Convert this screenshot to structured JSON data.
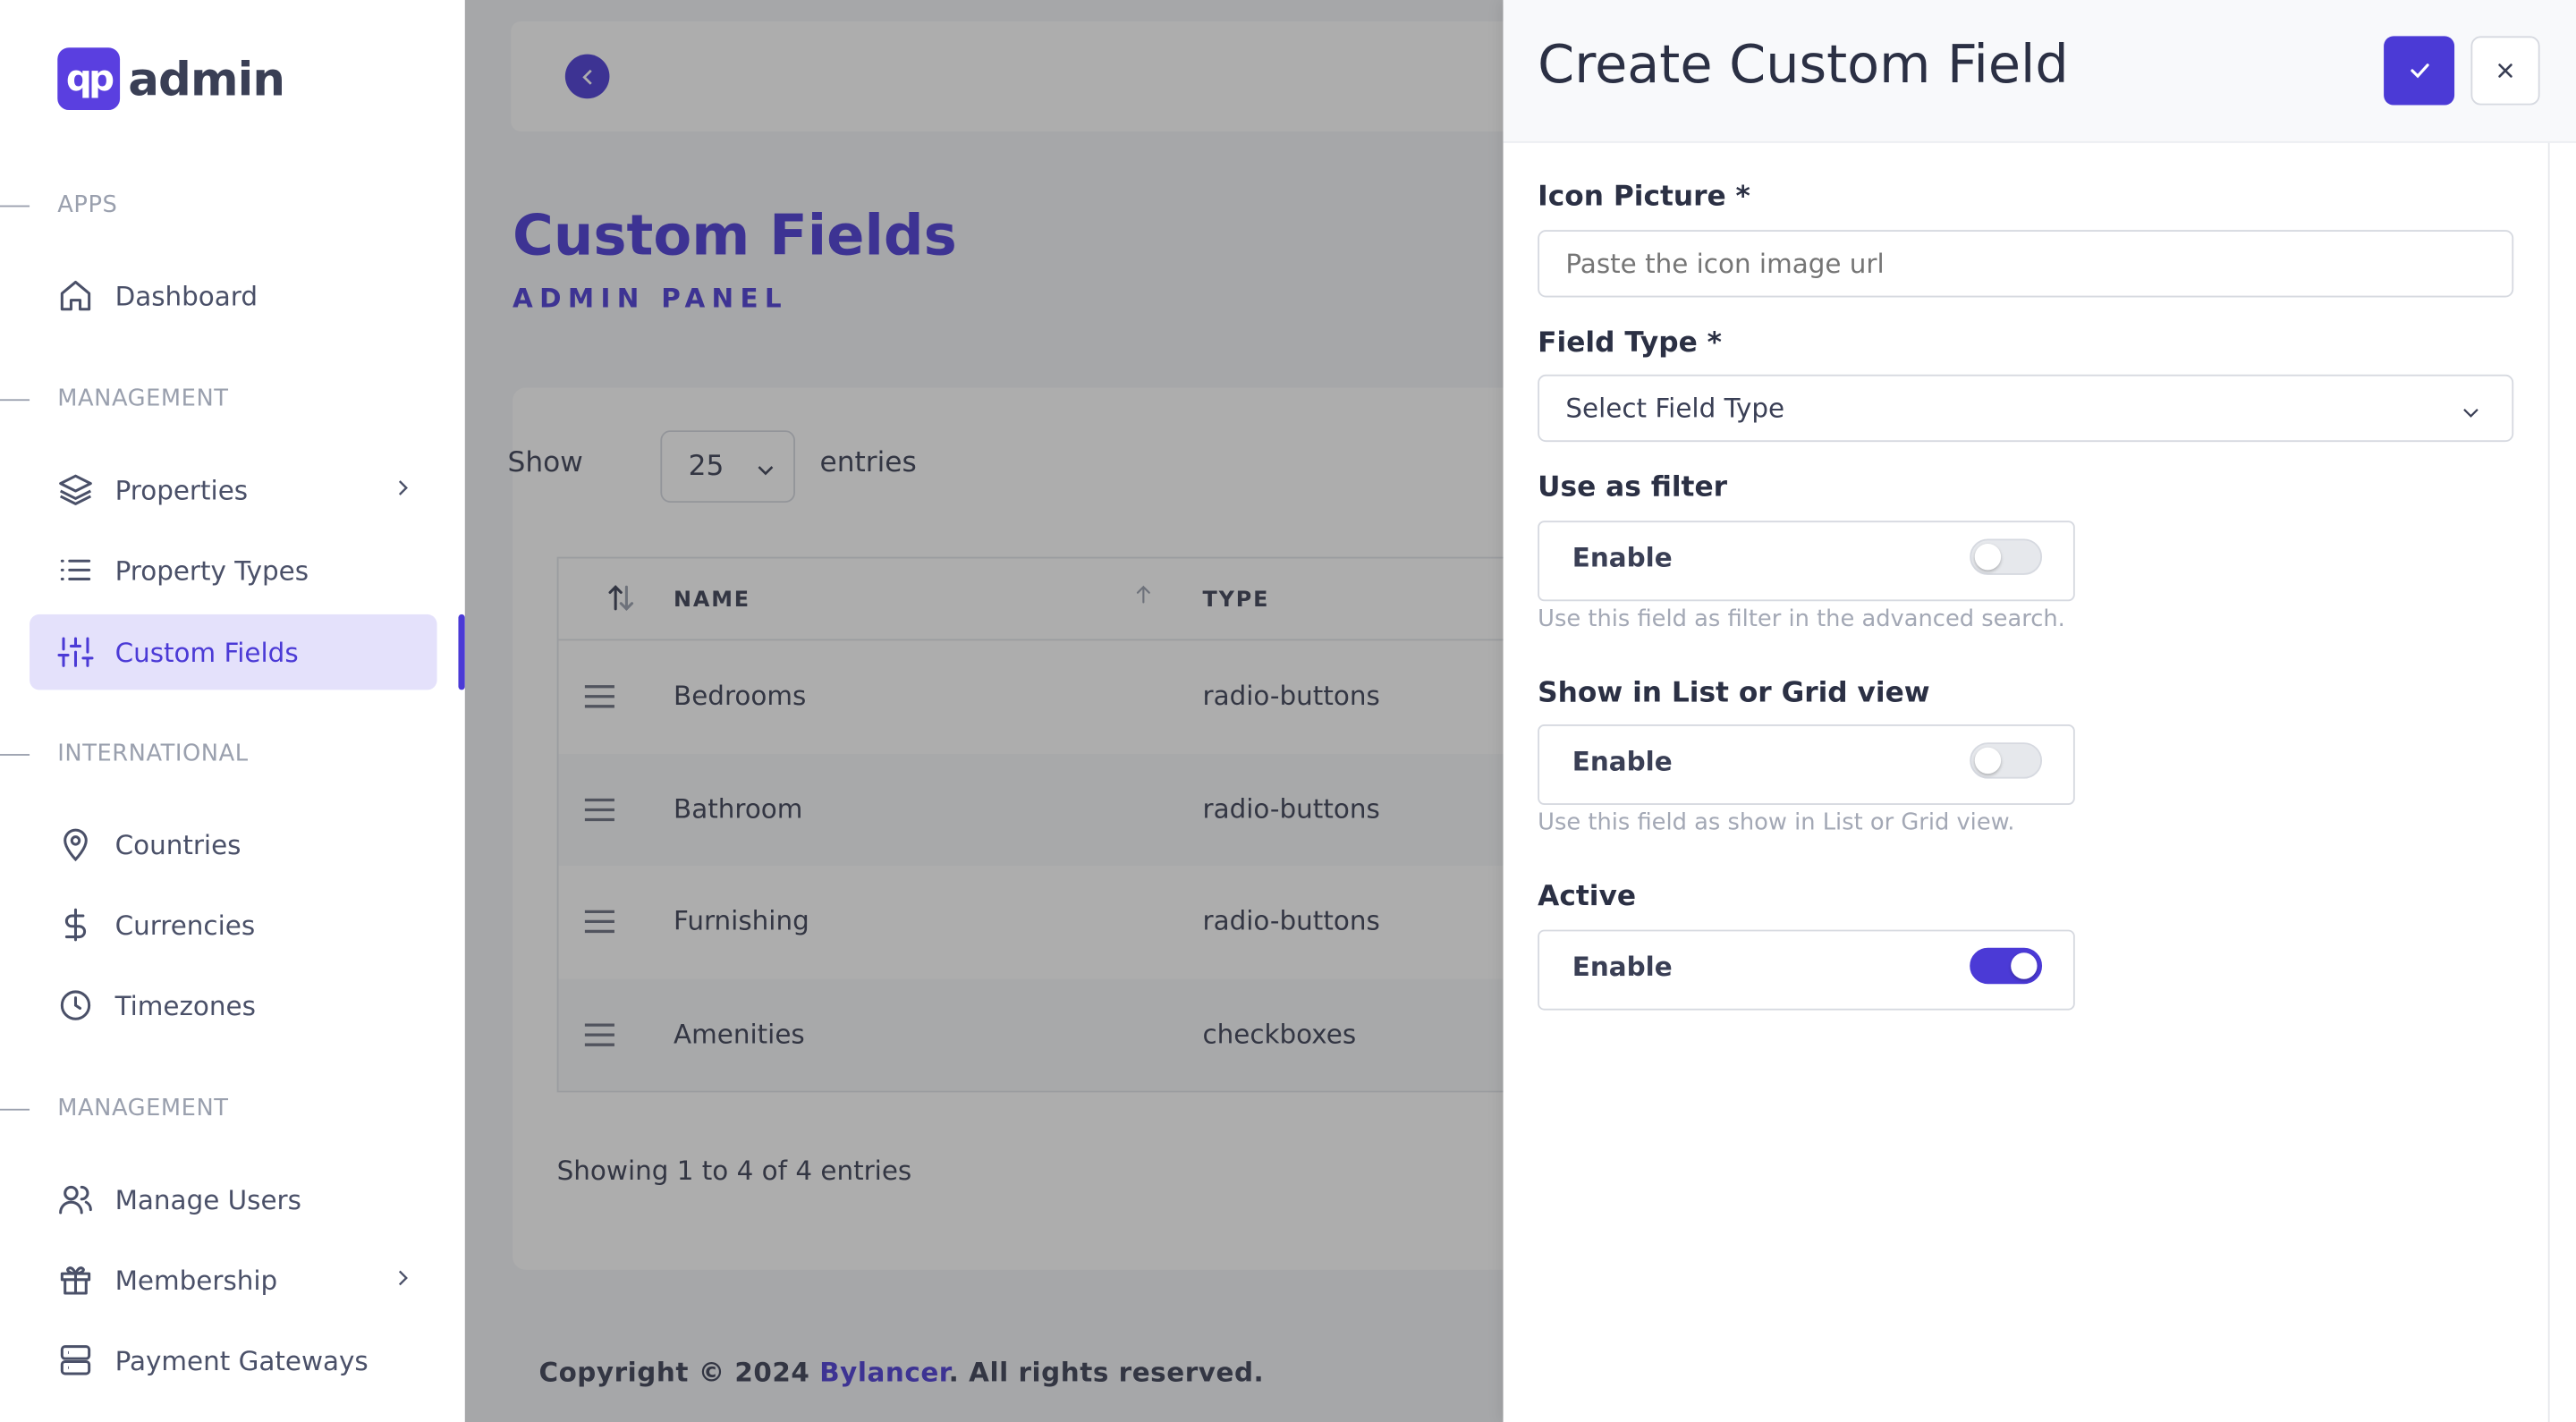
{
  "brand": {
    "logo_mark": "qp",
    "logo_text": "admin"
  },
  "sidebar": {
    "sections": [
      {
        "label": "APPS"
      },
      {
        "label": "MANAGEMENT"
      },
      {
        "label": "INTERNATIONAL"
      },
      {
        "label": "MANAGEMENT"
      }
    ],
    "items": [
      {
        "label": "Dashboard",
        "icon": "home-icon"
      },
      {
        "label": "Properties",
        "icon": "layers-icon"
      },
      {
        "label": "Property Types",
        "icon": "list-icon"
      },
      {
        "label": "Custom Fields",
        "icon": "sliders-icon",
        "active": true
      },
      {
        "label": "Countries",
        "icon": "map-pin-icon"
      },
      {
        "label": "Currencies",
        "icon": "dollar-icon"
      },
      {
        "label": "Timezones",
        "icon": "clock-icon"
      },
      {
        "label": "Manage Users",
        "icon": "users-icon"
      },
      {
        "label": "Membership",
        "icon": "gift-icon"
      },
      {
        "label": "Payment Gateways",
        "icon": "server-icon"
      }
    ]
  },
  "page": {
    "title": "Custom Fields",
    "subtitle": "ADMIN PANEL"
  },
  "table": {
    "show_label": "Show",
    "page_size": "25",
    "entries_label": "entries",
    "headers": {
      "name": "NAME",
      "type": "TYPE"
    },
    "rows": [
      {
        "name": "Bedrooms",
        "type": "radio-buttons"
      },
      {
        "name": "Bathroom",
        "type": "radio-buttons"
      },
      {
        "name": "Furnishing",
        "type": "radio-buttons"
      },
      {
        "name": "Amenities",
        "type": "checkboxes"
      }
    ],
    "info": "Showing 1 to 4 of 4 entries"
  },
  "footer": {
    "prefix": "Copyright © 2024 ",
    "link": "Bylancer",
    "suffix": ". All rights reserved."
  },
  "panel": {
    "title": "Create Custom Field",
    "icon_picture": {
      "label": "Icon Picture *",
      "placeholder": "Paste the icon image url"
    },
    "field_type": {
      "label": "Field Type *",
      "value": "Select Field Type"
    },
    "use_as_filter": {
      "label": "Use as filter",
      "toggle_label": "Enable",
      "enabled": false,
      "help": "Use this field as filter in the advanced search."
    },
    "show_in_list": {
      "label": "Show in List or Grid view",
      "toggle_label": "Enable",
      "enabled": false,
      "help": "Use this field as show in List or Grid view."
    },
    "active": {
      "label": "Active",
      "toggle_label": "Enable",
      "enabled": true
    }
  },
  "colors": {
    "accent": "#4b3ad6",
    "brand": "#5a3fe0"
  }
}
